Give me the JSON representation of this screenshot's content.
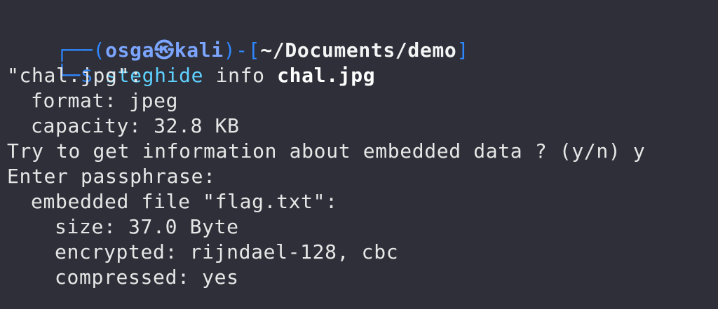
{
  "prompt": {
    "corner_top": "┌──(",
    "user": "osga",
    "at_symbol": "㉿",
    "host": "kali",
    "mid": ")-[",
    "path": "~/Documents/demo",
    "close": "]",
    "corner_bottom": "└─",
    "dollar": "$ ",
    "command": "steghide",
    "args": " info ",
    "file_arg": "chal.jpg"
  },
  "output": {
    "file_line": "\"chal.jpg\":",
    "format_line": "format: jpeg",
    "capacity_line": "capacity: 32.8 KB",
    "question_line": "Try to get information about embedded data ? (y/n) y",
    "passphrase_line": "Enter passphrase:",
    "embedded_line": "embedded file \"flag.txt\":",
    "size_line": "size: 37.0 Byte",
    "encrypted_line": "encrypted: rijndael-128, cbc",
    "compressed_line": "compressed: yes"
  }
}
